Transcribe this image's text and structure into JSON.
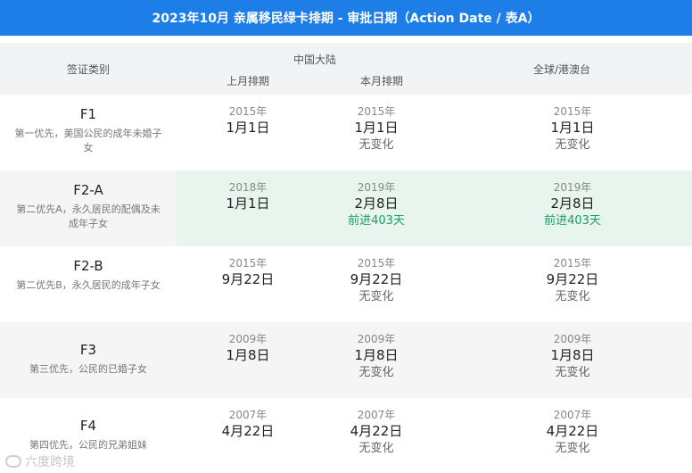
{
  "title": "2023年10月 亲属移民绿卡排期 - 审批日期（Action Date / 表A）",
  "headers": {
    "category": "签证类别",
    "china": "中国大陆",
    "last_month": "上月排期",
    "this_month": "本月排期",
    "global": "全球/港澳台"
  },
  "rows": [
    {
      "code": "F1",
      "desc": "第一优先，美国公民的成年未婚子女",
      "last": {
        "year": "2015年",
        "md": "1月1日"
      },
      "this": {
        "year": "2015年",
        "md": "1月1日",
        "change": "无变化"
      },
      "global": {
        "year": "2015年",
        "md": "1月1日",
        "change": "无变化"
      }
    },
    {
      "code": "F2-A",
      "desc": "第二优先A，永久居民的配偶及未成年子女",
      "last": {
        "year": "2018年",
        "md": "1月1日"
      },
      "this": {
        "year": "2019年",
        "md": "2月8日",
        "change": "前进403天"
      },
      "global": {
        "year": "2019年",
        "md": "2月8日",
        "change": "前进403天"
      }
    },
    {
      "code": "F2-B",
      "desc": "第二优先B，永久居民的成年子女",
      "last": {
        "year": "2015年",
        "md": "9月22日"
      },
      "this": {
        "year": "2015年",
        "md": "9月22日",
        "change": "无变化"
      },
      "global": {
        "year": "2015年",
        "md": "9月22日",
        "change": "无变化"
      }
    },
    {
      "code": "F3",
      "desc": "第三优先，公民的已婚子女",
      "last": {
        "year": "2009年",
        "md": "1月8日"
      },
      "this": {
        "year": "2009年",
        "md": "1月8日",
        "change": "无变化"
      },
      "global": {
        "year": "2009年",
        "md": "1月8日",
        "change": "无变化"
      }
    },
    {
      "code": "F4",
      "desc": "第四优先，公民的兄弟姐妹",
      "last": {
        "year": "2007年",
        "md": "4月22日"
      },
      "this": {
        "year": "2007年",
        "md": "4月22日",
        "change": "无变化"
      },
      "global": {
        "year": "2007年",
        "md": "4月22日",
        "change": "无变化"
      }
    }
  ],
  "watermark": "六度跨境",
  "colors": {
    "title_bg": "#1e7ee8",
    "header_bg": "#f2f3f5",
    "alt_row_bg": "#f5f5f6",
    "highlight_bg": "#e8f5ee",
    "advance_text": "#1aa060"
  }
}
